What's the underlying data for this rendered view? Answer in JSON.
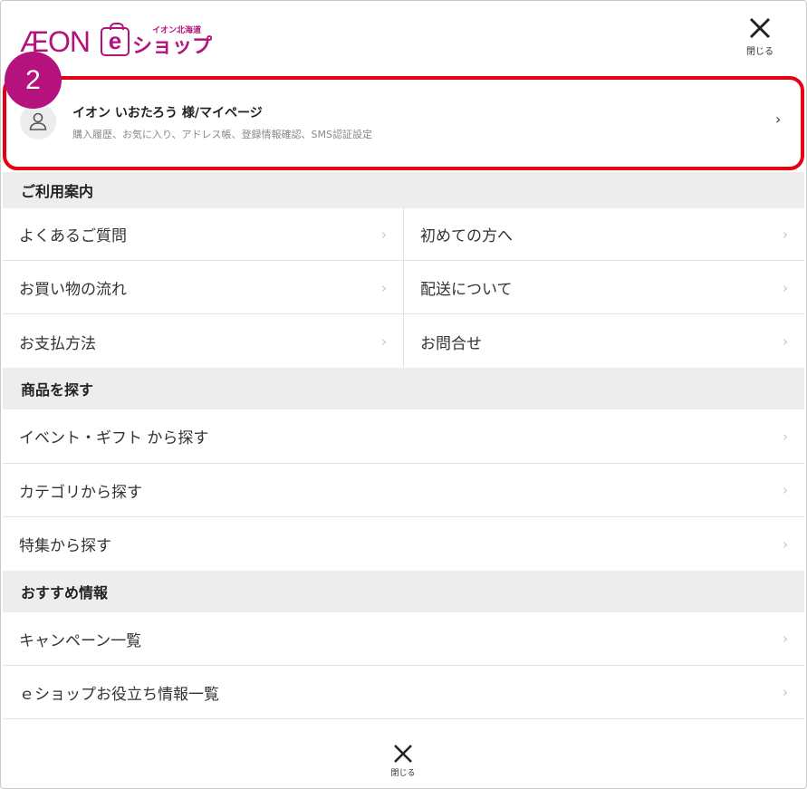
{
  "header": {
    "logo_aeon": "ÆON",
    "logo_e": "e",
    "logo_small": "イオン北海道",
    "logo_shop": "ショップ",
    "close_icon": "close-icon",
    "close_label": "閉じる"
  },
  "step_badge": "2",
  "mypage": {
    "icon": "user-icon",
    "name": "イオン いおたろう 様/マイページ",
    "description": "購入履歴、お気に入り、アドレス帳、登録情報確認、SMS認証設定",
    "chevron": "›"
  },
  "colors": {
    "brand": "#b5127e",
    "highlight": "#e60012",
    "section_bg": "#ededed"
  },
  "guide": {
    "heading": "ご利用案内",
    "items": [
      {
        "label": "よくあるご質問"
      },
      {
        "label": "初めての方へ"
      },
      {
        "label": "お買い物の流れ"
      },
      {
        "label": "配送について"
      },
      {
        "label": "お支払方法"
      },
      {
        "label": "お問合せ"
      }
    ]
  },
  "search": {
    "heading": "商品を探す",
    "items": [
      {
        "label": "イベント・ギフト から探す"
      },
      {
        "label": "カテゴリから探す"
      },
      {
        "label": "特集から探す"
      }
    ]
  },
  "recommend": {
    "heading": "おすすめ情報",
    "items": [
      {
        "label": "キャンペーン一覧"
      },
      {
        "label": "ｅショップお役立ち情報一覧"
      }
    ]
  },
  "chevron": "›",
  "footer": {
    "close_icon": "close-icon",
    "close_label": "閉じる"
  }
}
